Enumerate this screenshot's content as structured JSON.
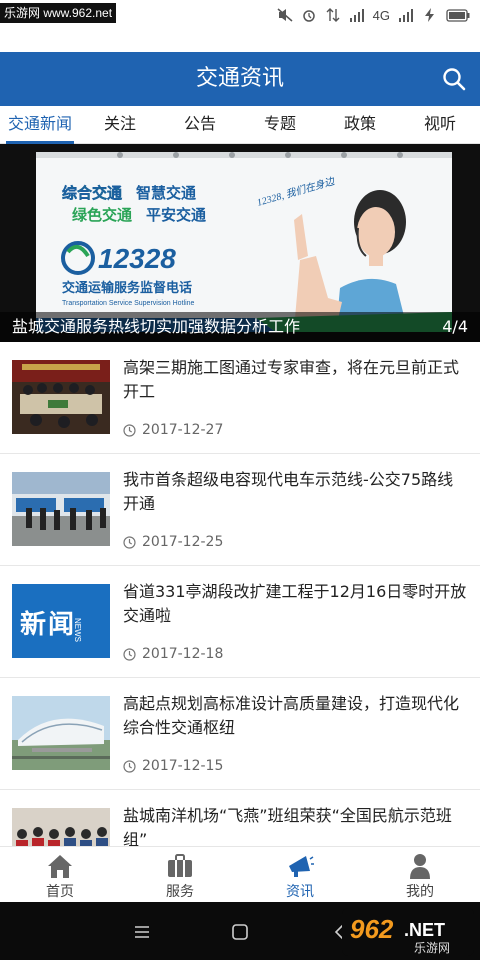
{
  "status_bar": {
    "watermark": "乐游网 www.962.net",
    "network": "4G"
  },
  "header": {
    "title": "交通资讯",
    "search_icon": "search-icon"
  },
  "tabs": [
    {
      "label": "交通新闻",
      "active": true
    },
    {
      "label": "关注",
      "active": false
    },
    {
      "label": "公告",
      "active": false
    },
    {
      "label": "专题",
      "active": false
    },
    {
      "label": "政策",
      "active": false
    },
    {
      "label": "视听",
      "active": false
    }
  ],
  "banner": {
    "caption": "盐城交通服务热线切实加强数据分析工作",
    "counter": "4/4",
    "board": {
      "slogan_1": "综合交通",
      "slogan_2": "智慧交通",
      "slogan_3": "绿色交通",
      "slogan_4": "平安交通",
      "hotline_number": "12328",
      "hotline_name": "交通运输服务监督电话",
      "hotline_english": "Transportation Service Supervision Hotline",
      "handwriting": "12328, 我们在身边"
    }
  },
  "news": [
    {
      "title": "高架三期施工图通过专家审查，将在元旦前正式开工",
      "date": "2017-12-27"
    },
    {
      "title": "我市首条超级电容现代电车示范线-公交75路线开通",
      "date": "2017-12-25"
    },
    {
      "title": "省道331亭湖段改扩建工程于12月16日零时开放交通啦",
      "date": "2017-12-18",
      "thumb_text": "新闻",
      "thumb_text_en": "NEWS"
    },
    {
      "title": "高起点规划高标准设计高质量建设，打造现代化综合性交通枢纽",
      "date": "2017-12-15"
    },
    {
      "title": "盐城南洋机场“飞燕”班组荣获“全国民航示范班组”",
      "date": ""
    }
  ],
  "bottom_nav": [
    {
      "label": "首页",
      "icon": "home-icon",
      "active": false
    },
    {
      "label": "服务",
      "icon": "briefcase-icon",
      "active": false
    },
    {
      "label": "资讯",
      "icon": "megaphone-icon",
      "active": true
    },
    {
      "label": "我的",
      "icon": "person-icon",
      "active": false
    }
  ],
  "watermark_logo": {
    "number": "962",
    "suffix": ".NET",
    "name": "乐游网"
  },
  "colors": {
    "primary": "#1f63b1",
    "text": "#222222",
    "muted": "#666666"
  }
}
